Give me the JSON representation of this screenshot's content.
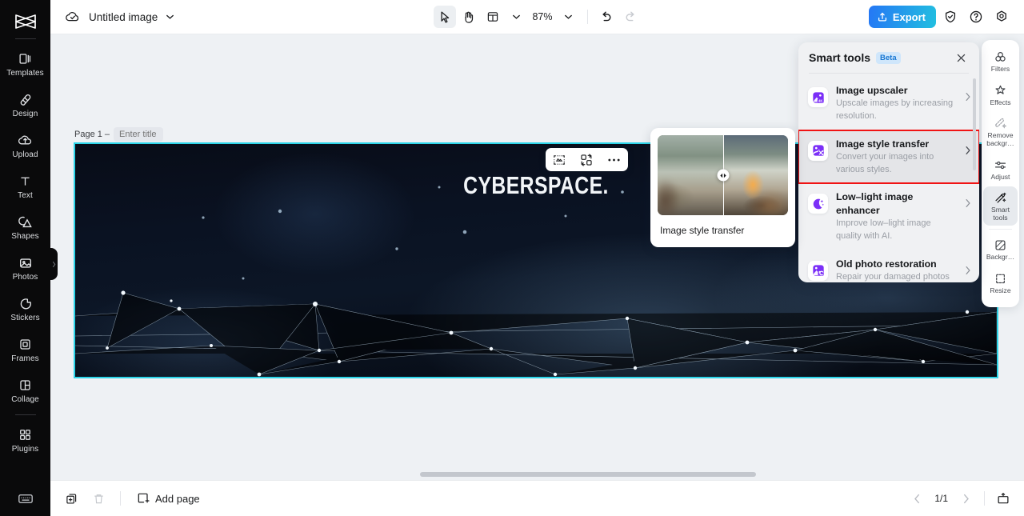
{
  "app": {
    "logo": "capcut-logo"
  },
  "left_rail": {
    "items": [
      {
        "label": "Templates",
        "icon": "templates-icon"
      },
      {
        "label": "Design",
        "icon": "design-icon"
      },
      {
        "label": "Upload",
        "icon": "upload-cloud-icon"
      },
      {
        "label": "Text",
        "icon": "text-icon"
      },
      {
        "label": "Shapes",
        "icon": "shapes-icon"
      },
      {
        "label": "Photos",
        "icon": "photos-icon"
      },
      {
        "label": "Stickers",
        "icon": "stickers-icon"
      },
      {
        "label": "Frames",
        "icon": "frames-icon"
      },
      {
        "label": "Collage",
        "icon": "collage-icon"
      },
      {
        "label": "Plugins",
        "icon": "plugins-icon"
      }
    ],
    "bottom_icon": "keyboard-shortcuts-icon"
  },
  "topbar": {
    "cloud_icon": "cloud-saved-icon",
    "doc_title": "Untitled image",
    "doc_menu_icon": "chevron-down-icon",
    "select_tool_icon": "cursor-select-icon",
    "hand_tool_icon": "hand-pan-icon",
    "layout_tool_icon": "layout-grid-icon",
    "layout_chevron_icon": "chevron-down-icon",
    "zoom_level": "87%",
    "zoom_chevron_icon": "chevron-down-icon",
    "undo_icon": "undo-icon",
    "redo_icon": "redo-icon",
    "export_label": "Export",
    "export_icon": "export-upload-icon",
    "export_color": "#2577f5",
    "shield_icon": "shield-check-icon",
    "help_icon": "help-question-icon",
    "settings_icon": "settings-gear-icon"
  },
  "canvas": {
    "page_label": "Page 1 –",
    "page_title_placeholder": "Enter title",
    "page_title_value": "",
    "artboard_text": "CYBERSPACE.",
    "selection_color": "#2bd4e8",
    "float_toolbar": [
      {
        "icon": "magic-cutout-icon"
      },
      {
        "icon": "replace-image-icon"
      },
      {
        "icon": "more-options-icon"
      }
    ]
  },
  "bottombar": {
    "duplicate_icon": "duplicate-page-icon",
    "delete_icon": "delete-page-icon",
    "add_page_label": "Add page",
    "add_page_icon": "add-page-icon",
    "prev_icon": "chevron-left-icon",
    "page_count": "1/1",
    "next_icon": "chevron-right-icon",
    "presentation_icon": "presentation-icon"
  },
  "right_rail": {
    "items": [
      {
        "label": "Filters",
        "icon": "filters-icon",
        "selected": false
      },
      {
        "label": "Effects",
        "icon": "effects-sparkle-icon",
        "selected": false
      },
      {
        "label": "Remove\nbackgr…",
        "icon": "remove-background-icon",
        "selected": false
      },
      {
        "label": "Adjust",
        "icon": "adjust-sliders-icon",
        "selected": false
      },
      {
        "label": "Smart\ntools",
        "icon": "smart-tools-wand-icon",
        "selected": true
      },
      {
        "label": "Backgr…",
        "icon": "background-icon",
        "selected": false
      },
      {
        "label": "Resize",
        "icon": "resize-icon",
        "selected": false
      }
    ]
  },
  "smart_panel": {
    "title": "Smart tools",
    "badge": "Beta",
    "badge_color": "#1877d2",
    "close_icon": "close-icon",
    "chevron_icon": "chevron-right-icon",
    "icon_accent": "#7b2ff7",
    "highlight_color": "#f11414",
    "items": [
      {
        "name": "Image upscaler",
        "desc": "Upscale images by increasing resolution.",
        "icon": "image-upscaler-4k-icon",
        "highlighted": false
      },
      {
        "name": "Image style transfer",
        "desc": "Convert your images into various styles.",
        "icon": "image-style-transfer-icon",
        "highlighted": true
      },
      {
        "name": "Low–light image enhancer",
        "desc": "Improve low–light image quality with AI.",
        "icon": "low-light-moon-icon",
        "highlighted": false
      },
      {
        "name": "Old photo restoration",
        "desc": "Repair your damaged photos or bring them new life with…",
        "icon": "old-photo-restoration-icon",
        "highlighted": false
      }
    ]
  },
  "preview_card": {
    "label": "Image style transfer",
    "slider_handle_icon": "before-after-slider-handle"
  }
}
